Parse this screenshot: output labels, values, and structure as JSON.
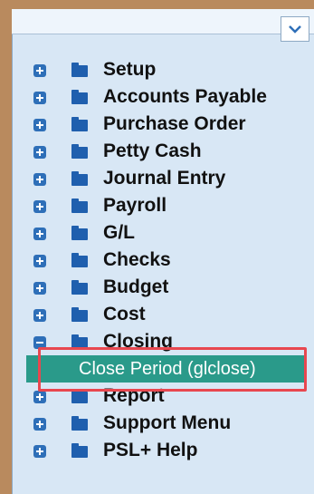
{
  "tree": {
    "items": [
      {
        "label": "Setup"
      },
      {
        "label": "Accounts Payable"
      },
      {
        "label": "Purchase Order"
      },
      {
        "label": "Petty Cash"
      },
      {
        "label": "Journal Entry"
      },
      {
        "label": "Payroll"
      },
      {
        "label": "G/L"
      },
      {
        "label": "Checks"
      },
      {
        "label": "Budget"
      },
      {
        "label": "Cost"
      },
      {
        "label": "Closing",
        "expanded": true
      },
      {
        "label": "Report"
      },
      {
        "label": "Support Menu"
      },
      {
        "label": "PSL+ Help"
      }
    ],
    "selected_child": {
      "label": "Close Period (glclose)"
    }
  },
  "colors": {
    "selection": "#2a9a8a",
    "highlight_box": "#e8474f",
    "folder": "#1f5fae"
  }
}
